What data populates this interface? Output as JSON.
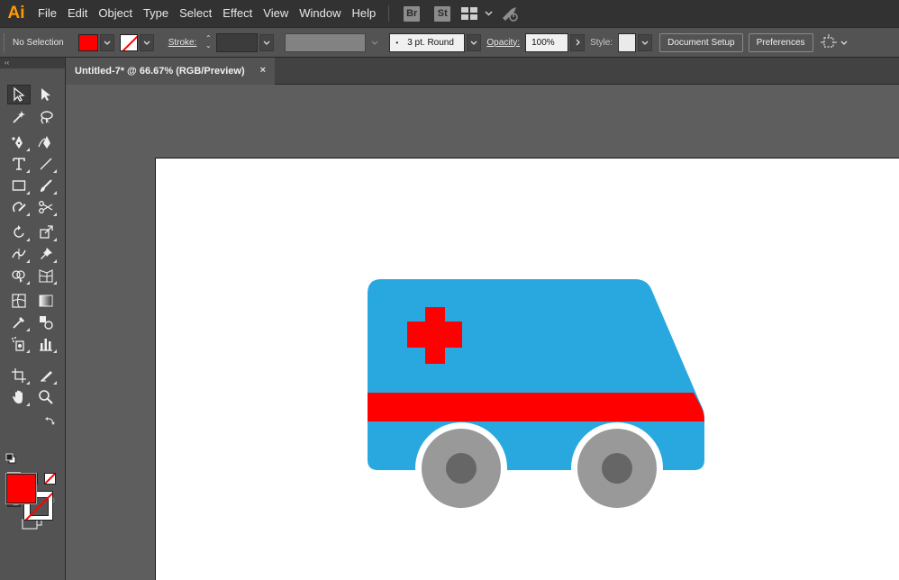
{
  "app": {
    "logo": "Ai",
    "accent_color": "#ff9a00"
  },
  "menu": {
    "items": [
      "File",
      "Edit",
      "Object",
      "Type",
      "Select",
      "Effect",
      "View",
      "Window",
      "Help"
    ],
    "badges": [
      "Br",
      "St"
    ],
    "icons": [
      "workspace-grid-icon",
      "chevron-down-icon",
      "gpu-rocket-icon"
    ]
  },
  "control_bar": {
    "selection_label": "No Selection",
    "fill_color": "#ff0000",
    "stroke_label": "Stroke:",
    "brush_label": "3 pt. Round",
    "opacity_label": "Opacity:",
    "opacity_value": "100%",
    "style_label": "Style:",
    "document_setup_button": "Document Setup",
    "preferences_button": "Preferences"
  },
  "document": {
    "tab_title": "Untitled-7* @ 66.67% (RGB/Preview)",
    "close_glyph": "×"
  },
  "toolbar": {
    "collapse_glyph": "‹‹",
    "tools": [
      "selection-tool",
      "direct-selection-tool",
      "magic-wand-tool",
      "lasso-tool",
      "pen-tool",
      "curvature-tool",
      "type-tool",
      "line-segment-tool",
      "rectangle-tool",
      "paintbrush-tool",
      "shaper-tool",
      "scissors-tool",
      "rotate-tool",
      "scale-tool",
      "width-tool",
      "puppet-warp-tool",
      "shape-builder-tool",
      "perspective-grid-tool",
      "mesh-tool",
      "gradient-tool",
      "eyedropper-tool",
      "blend-tool",
      "symbol-sprayer-tool",
      "column-graph-tool",
      "artboard-tool",
      "slice-tool",
      "hand-tool",
      "zoom-tool"
    ],
    "fill_color": "#ff0000",
    "stroke_color": "#ff0000"
  },
  "artwork": {
    "body_color": "#29a8e0",
    "stripe_color": "#ff0000",
    "cross_color": "#ff0000",
    "tire_color": "#999999",
    "hub_color": "#666666"
  }
}
